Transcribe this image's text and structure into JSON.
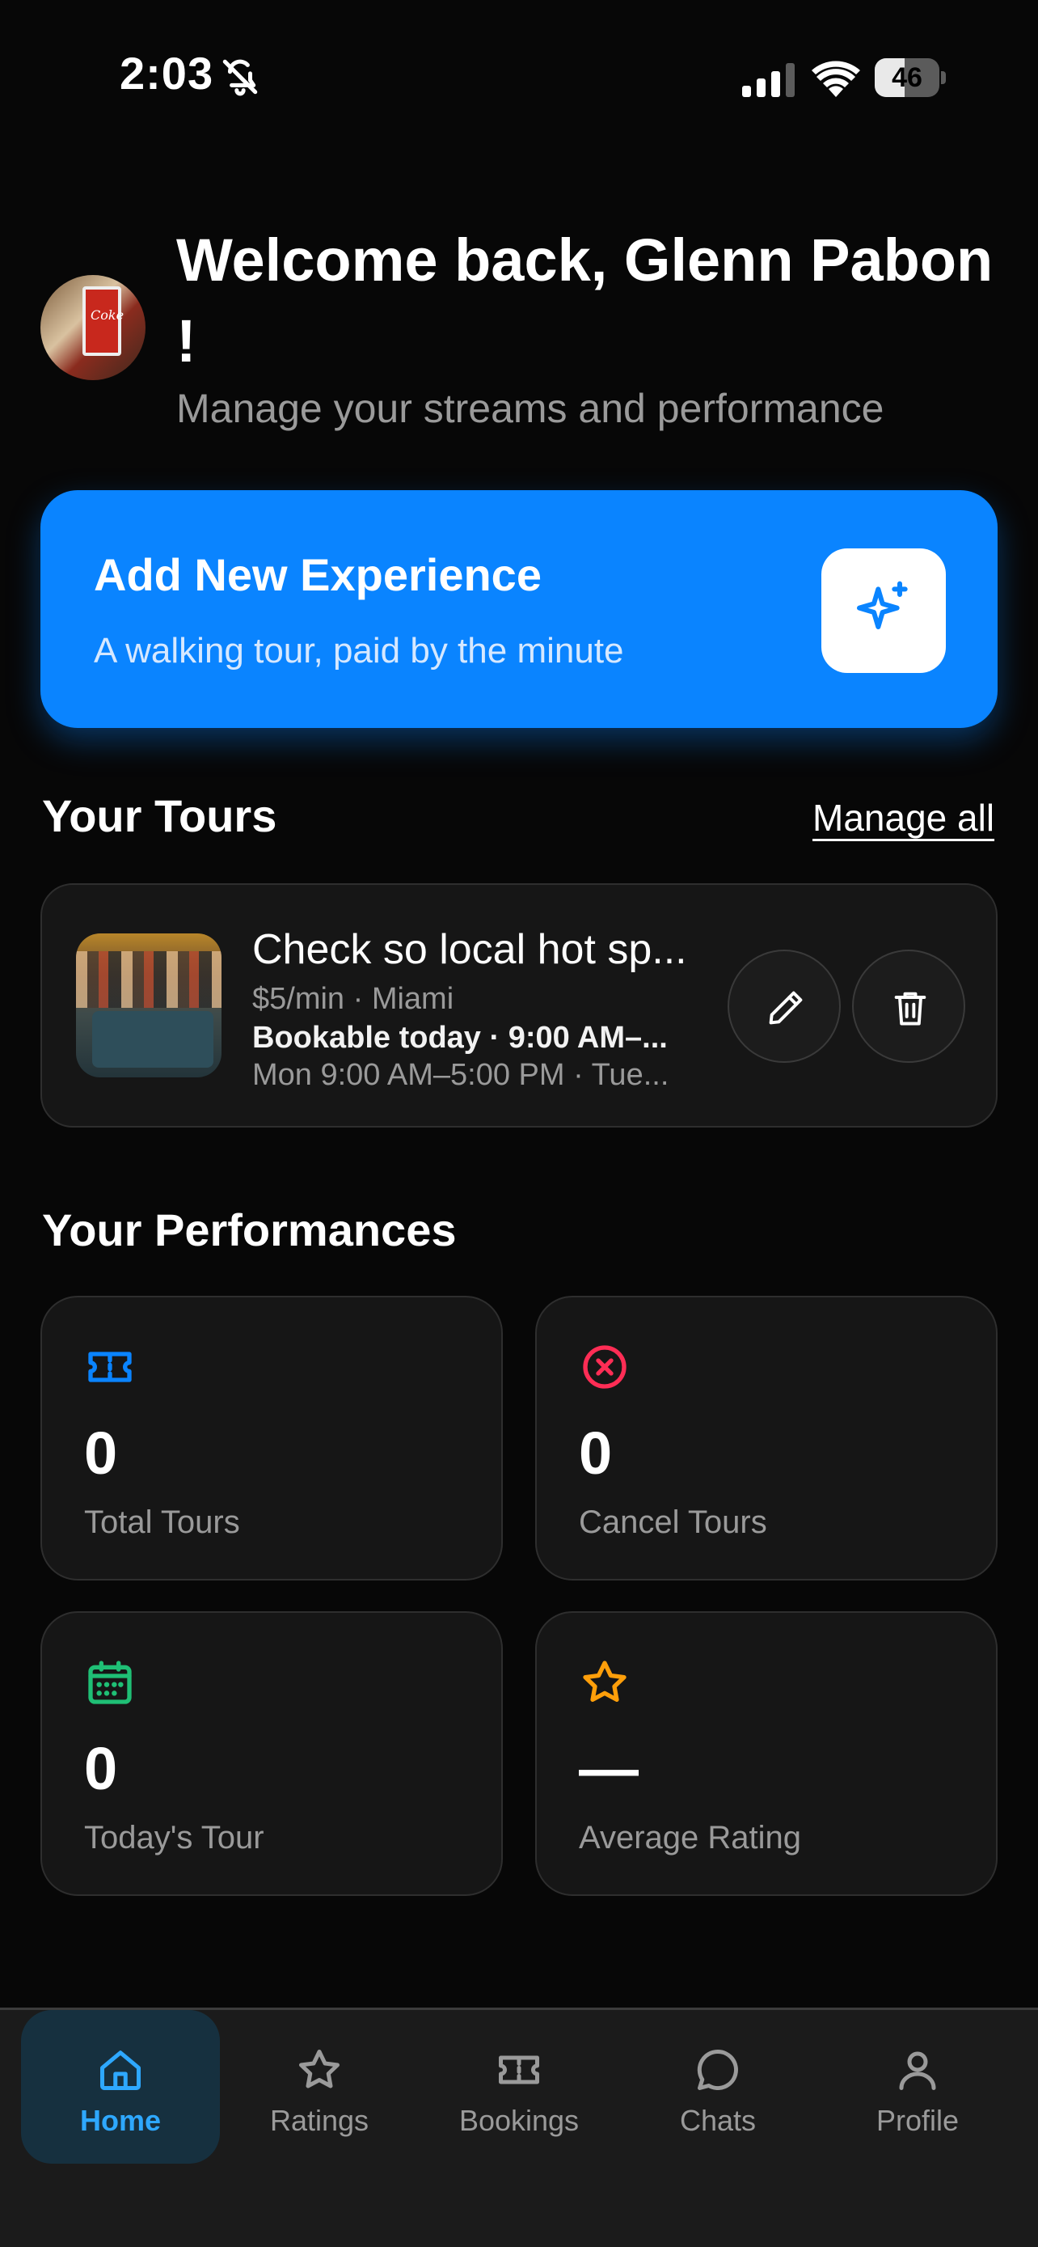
{
  "status": {
    "time": "2:03",
    "battery": "46",
    "battery_level": 0.46
  },
  "header": {
    "title": "Welcome back, Glenn Pabon !",
    "subtitle": "Manage your streams and performance",
    "avatar_label": "Coke"
  },
  "cta": {
    "title": "Add New Experience",
    "subtitle": "A walking tour, paid by the minute",
    "icon": "sparkle-icon"
  },
  "tours": {
    "section_title": "Your Tours",
    "manage_label": "Manage all",
    "items": [
      {
        "title": "Check so local hot sp...",
        "meta": "$5/min · Miami",
        "bookable": "Bookable today · 9:00 AM–...",
        "hours": "Mon 9:00 AM–5:00 PM · Tue..."
      }
    ]
  },
  "performance": {
    "section_title": "Your Performances",
    "stats": [
      {
        "value": "0",
        "label": "Total Tours",
        "icon": "ticket-icon",
        "color": "#0a84ff"
      },
      {
        "value": "0",
        "label": "Cancel Tours",
        "icon": "cancel-circle-icon",
        "color": "#ff2d55"
      },
      {
        "value": "0",
        "label": "Today's Tour",
        "icon": "calendar-icon",
        "color": "#1fbf75"
      },
      {
        "value": "—",
        "label": "Average Rating",
        "icon": "star-icon",
        "color": "#ff9f0a"
      }
    ]
  },
  "tabbar": {
    "items": [
      {
        "label": "Home",
        "icon": "home-icon",
        "active": true
      },
      {
        "label": "Ratings",
        "icon": "star-icon"
      },
      {
        "label": "Bookings",
        "icon": "ticket-icon"
      },
      {
        "label": "Chats",
        "icon": "chat-bubble-icon"
      },
      {
        "label": "Profile",
        "icon": "person-icon"
      }
    ],
    "active_color": "#2ea8ff"
  }
}
